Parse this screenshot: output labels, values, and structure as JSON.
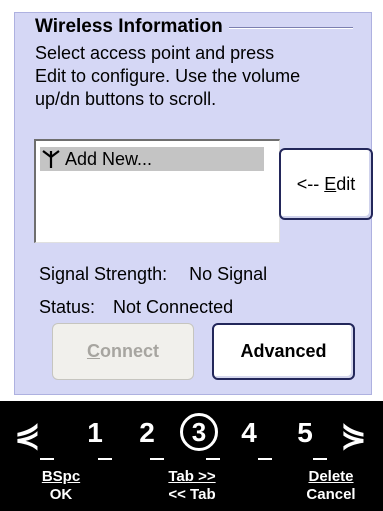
{
  "group": {
    "title": "Wireless Information"
  },
  "instructions": [
    "Select access point and press",
    "Edit to configure. Use the volume",
    "up/dn buttons to scroll."
  ],
  "access_points": [
    {
      "label": "Add New...",
      "icon": "antenna-icon",
      "selected": true
    }
  ],
  "buttons": {
    "edit_prefix": "<-- ",
    "edit_mnemonic": "E",
    "edit_rest": "dit",
    "connect_mnemonic": "C",
    "connect_rest": "onnect",
    "advanced": "Advanced"
  },
  "info": {
    "signal_label": "Signal Strength:",
    "signal_value": "No Signal",
    "status_label": "Status:",
    "status_value": "Not Connected"
  },
  "keybar": {
    "left_arrow": "⋞",
    "right_arrow": "⋟",
    "numbers": [
      "1",
      "2",
      "3",
      "4",
      "5"
    ],
    "active_number": "3",
    "softkeys": [
      {
        "top": "BSpc",
        "bottom": "OK"
      },
      {
        "top": "Tab >>",
        "bottom": "<< Tab"
      },
      {
        "top": "Delete",
        "bottom": "Cancel"
      }
    ]
  },
  "colors": {
    "panel_bg": "#d5d7f5",
    "list_selection": "#c4c4c4",
    "button_border": "#23275a",
    "keybar_bg": "#000000"
  }
}
